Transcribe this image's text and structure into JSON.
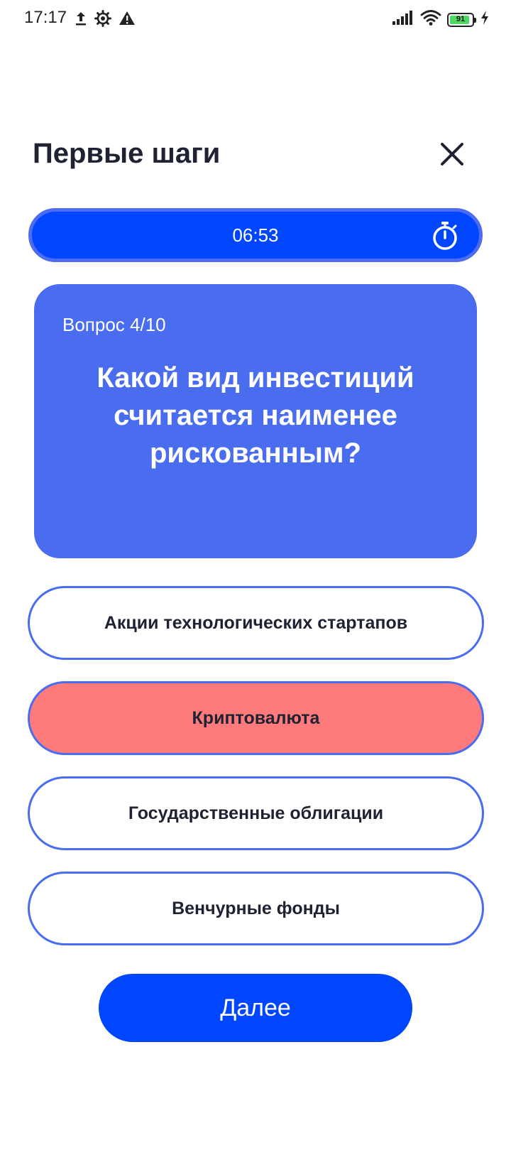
{
  "status_bar": {
    "time": "17:17",
    "battery_level": "91",
    "battery_fraction": 0.91,
    "icons": [
      "upload-icon",
      "gear-icon",
      "warning-icon",
      "signal-icon",
      "wifi-icon",
      "battery-icon",
      "charging-icon"
    ]
  },
  "header": {
    "title": "Первые шаги",
    "close_icon": "close-icon"
  },
  "timer": {
    "time": "06:53",
    "icon": "stopwatch-icon"
  },
  "question": {
    "number": "Вопрос 4/10",
    "text": "Какой вид инвестиций считается наименее рискованным?"
  },
  "answers": [
    {
      "label": "Акции технологических стартапов",
      "state": "default"
    },
    {
      "label": "Криптовалюта",
      "state": "wrong"
    },
    {
      "label": "Государственные облигации",
      "state": "default"
    },
    {
      "label": "Венчурные фонды",
      "state": "default"
    }
  ],
  "next_button": {
    "label": "Далее"
  },
  "colors": {
    "primary": "#0046ff",
    "card": "#4a6cee",
    "wrong_answer": "#ff7a7a",
    "text_dark": "#1f2233"
  }
}
